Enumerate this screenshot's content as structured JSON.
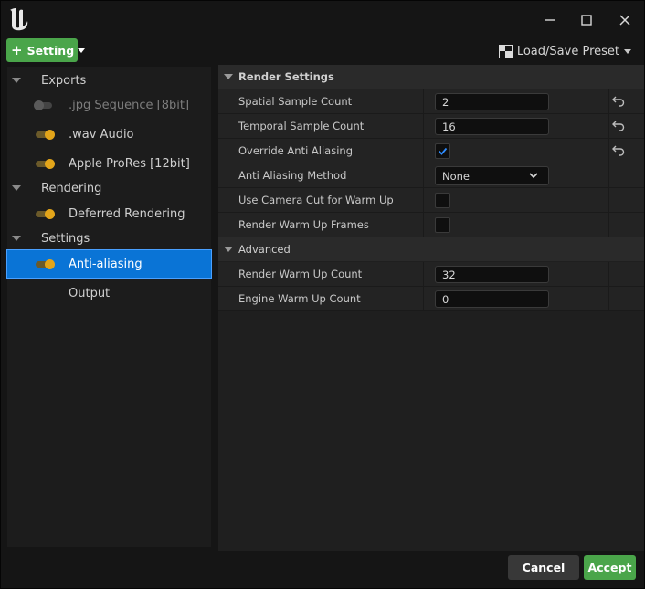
{
  "toolbar": {
    "setting_label": "Setting",
    "preset_label": "Load/Save Preset"
  },
  "tree": {
    "items": [
      {
        "kind": "group",
        "label": "Exports"
      },
      {
        "kind": "item",
        "label": ".jpg Sequence [8bit]",
        "enabled": false
      },
      {
        "kind": "item",
        "label": ".wav Audio",
        "enabled": true
      },
      {
        "kind": "item",
        "label": "Apple ProRes [12bit]",
        "enabled": true
      },
      {
        "kind": "group",
        "label": "Rendering"
      },
      {
        "kind": "item",
        "label": "Deferred Rendering",
        "enabled": true
      },
      {
        "kind": "group",
        "label": "Settings"
      },
      {
        "kind": "item",
        "label": "Anti-aliasing",
        "enabled": true,
        "selected": true
      },
      {
        "kind": "item",
        "label": "Output"
      }
    ]
  },
  "details": {
    "render_settings": {
      "title": "Render Settings",
      "spatial_sample_count": {
        "label": "Spatial Sample Count",
        "value": "2"
      },
      "temporal_sample_count": {
        "label": "Temporal Sample Count",
        "value": "16"
      },
      "override_anti_aliasing": {
        "label": "Override Anti Aliasing",
        "checked": true
      },
      "anti_aliasing_method": {
        "label": "Anti Aliasing Method",
        "value": "None"
      },
      "use_camera_cut": {
        "label": "Use Camera Cut for Warm Up",
        "checked": false
      },
      "render_warm_up_frames": {
        "label": "Render Warm Up Frames",
        "checked": false
      }
    },
    "advanced": {
      "title": "Advanced",
      "render_warm_up_count": {
        "label": "Render Warm Up Count",
        "value": "32"
      },
      "engine_warm_up_count": {
        "label": "Engine Warm Up Count",
        "value": "0"
      }
    }
  },
  "footer": {
    "cancel_label": "Cancel",
    "accept_label": "Accept"
  },
  "colors": {
    "accent_green": "#4aa54a",
    "selection_blue": "#0a74d6",
    "toggle_on": "#e3a51a"
  }
}
